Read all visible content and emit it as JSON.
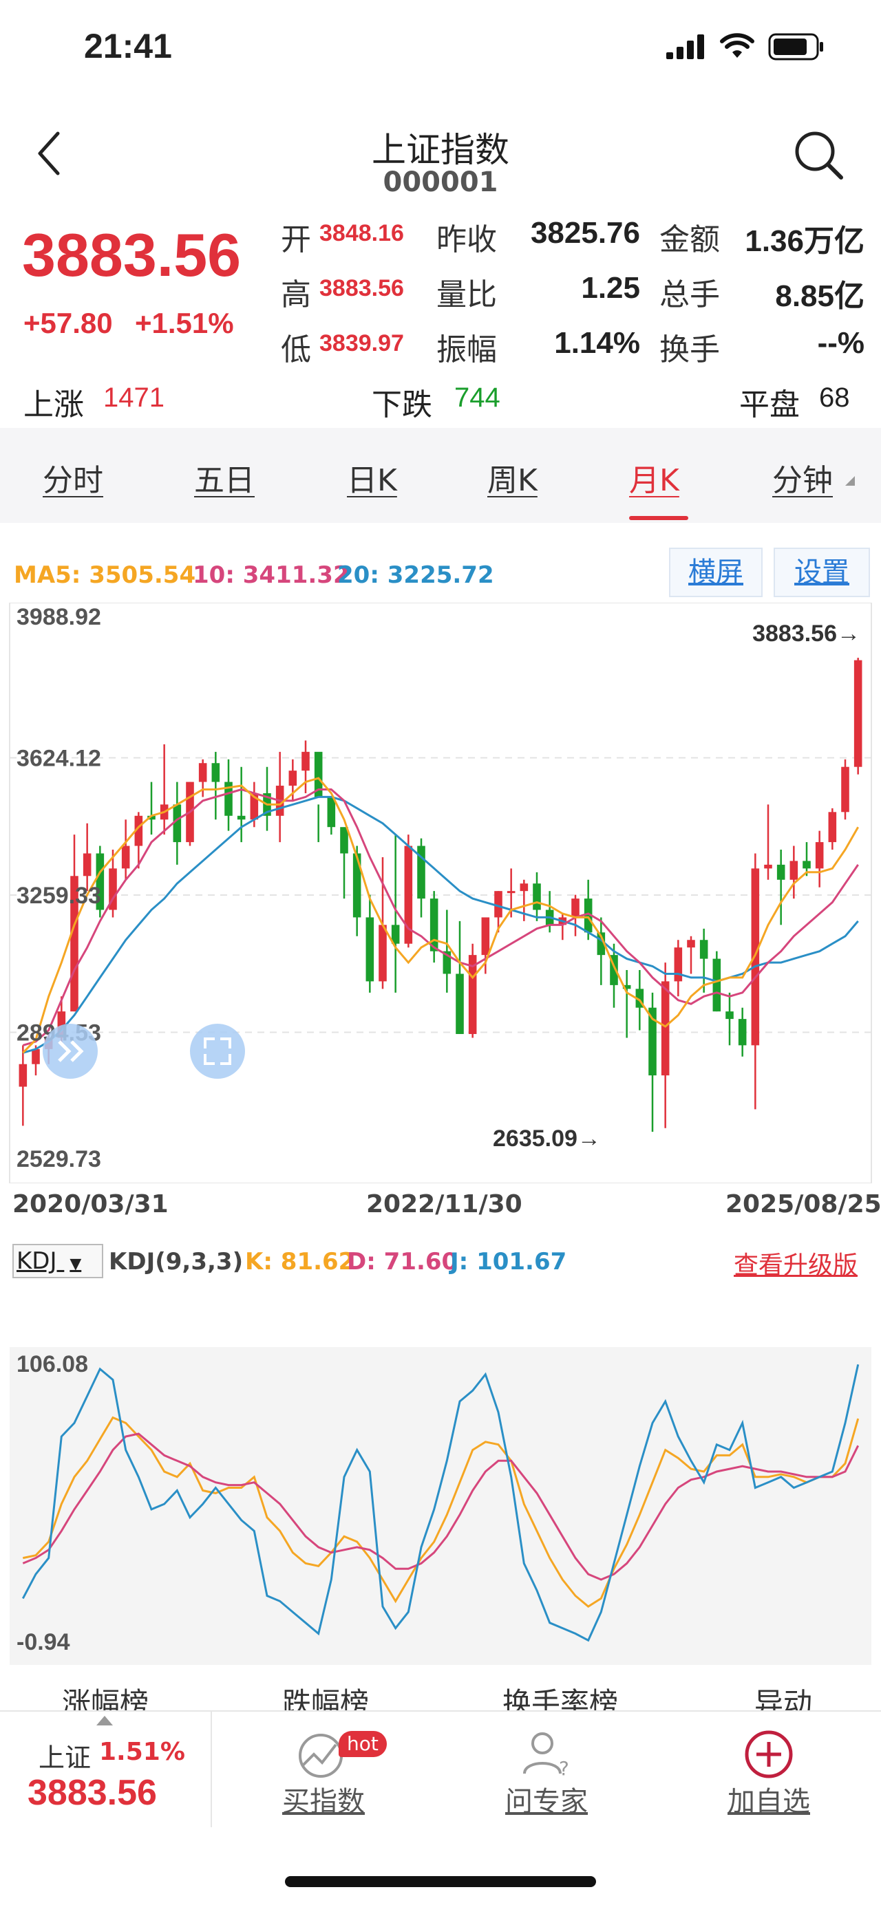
{
  "status_bar": {
    "time": "21:41"
  },
  "header": {
    "title": "上证指数",
    "code": "000001"
  },
  "quote": {
    "price": "3883.56",
    "change": "+57.80",
    "change_pct": "+1.51%",
    "stats": [
      {
        "label": "开",
        "value": "3848.16"
      },
      {
        "label": "昨收",
        "value": "3825.76"
      },
      {
        "label": "金额",
        "value": "1.36万亿"
      },
      {
        "label": "高",
        "value": "3883.56"
      },
      {
        "label": "量比",
        "value": "1.25"
      },
      {
        "label": "总手",
        "value": "8.85亿"
      },
      {
        "label": "低",
        "value": "3839.97"
      },
      {
        "label": "振幅",
        "value": "1.14%"
      },
      {
        "label": "换手",
        "value": "--%"
      }
    ],
    "breadth": {
      "up_label": "上涨",
      "up": "1471",
      "down_label": "下跌",
      "down": "744",
      "flat_label": "平盘",
      "flat": "68"
    }
  },
  "tabs": [
    "分时",
    "五日",
    "日K",
    "周K",
    "月K",
    "分钟"
  ],
  "active_tab": "月K",
  "ma_legend": {
    "ma5": "MA5: 3505.54",
    "ma10": "10: 3411.32",
    "ma20": "20: 3225.72"
  },
  "buttons": {
    "landscape": "横屏",
    "settings": "设置"
  },
  "kdj_legend": {
    "selector": "KDJ",
    "params": "KDJ(9,3,3)",
    "k": "K: 81.62",
    "d": "D: 71.60",
    "j": "J: 101.67",
    "upgrade": "查看升级版"
  },
  "lower_tabs": [
    "涨幅榜",
    "跌幅榜",
    "换手率榜",
    "异动"
  ],
  "bottom_bar": {
    "index_name": "上证",
    "index_pct": "1.51%",
    "index_price": "3883.56",
    "buy_index": "买指数",
    "hot_badge": "hot",
    "ask_expert": "问专家",
    "add_watch": "加自选"
  },
  "colors": {
    "up": "#e0313b",
    "down": "#1a9e2c",
    "ma5": "#f5a623",
    "ma10": "#d6467c",
    "ma20": "#2a8fc6"
  },
  "chart_data": [
    {
      "type": "candlestick",
      "title": "上证指数 月K",
      "y_ticks": [
        "3988.92",
        "3624.12",
        "3259.33",
        "2894.53",
        "2529.73"
      ],
      "ylim": [
        2529.73,
        3988.92
      ],
      "x_ticks": [
        "2020/03/31",
        "2022/11/30",
        "2025/08/25"
      ],
      "annotations": {
        "high": "3883.56→",
        "low": "2635.09→"
      },
      "ohlc": [
        [
          2750,
          2860,
          2646,
          2810
        ],
        [
          2810,
          2860,
          2780,
          2850
        ],
        [
          2850,
          2890,
          2810,
          2880
        ],
        [
          2880,
          2990,
          2860,
          2950
        ],
        [
          2950,
          3420,
          2950,
          3310
        ],
        [
          3310,
          3450,
          3270,
          3370
        ],
        [
          3370,
          3390,
          3200,
          3220
        ],
        [
          3220,
          3380,
          3200,
          3330
        ],
        [
          3330,
          3460,
          3300,
          3390
        ],
        [
          3390,
          3480,
          3330,
          3470
        ],
        [
          3470,
          3560,
          3420,
          3460
        ],
        [
          3460,
          3660,
          3420,
          3500
        ],
        [
          3500,
          3560,
          3340,
          3400
        ],
        [
          3400,
          3560,
          3390,
          3560
        ],
        [
          3560,
          3620,
          3520,
          3610
        ],
        [
          3610,
          3640,
          3460,
          3560
        ],
        [
          3560,
          3620,
          3430,
          3470
        ],
        [
          3470,
          3600,
          3400,
          3460
        ],
        [
          3460,
          3560,
          3440,
          3530
        ],
        [
          3530,
          3600,
          3430,
          3470
        ],
        [
          3470,
          3640,
          3400,
          3550
        ],
        [
          3550,
          3620,
          3510,
          3590
        ],
        [
          3590,
          3670,
          3530,
          3640
        ],
        [
          3640,
          3500,
          3400,
          3520
        ],
        [
          3520,
          3500,
          3420,
          3440
        ],
        [
          3440,
          3380,
          3250,
          3370
        ],
        [
          3370,
          3390,
          3150,
          3200
        ],
        [
          3200,
          3260,
          3000,
          3030
        ],
        [
          3030,
          3360,
          3010,
          3180
        ],
        [
          3180,
          3420,
          3000,
          3130
        ],
        [
          3130,
          3420,
          3120,
          3390
        ],
        [
          3390,
          3410,
          3200,
          3250
        ],
        [
          3250,
          3270,
          3080,
          3110
        ],
        [
          3110,
          3220,
          3000,
          3050
        ],
        [
          3050,
          3190,
          2890,
          2890
        ],
        [
          2890,
          3130,
          2880,
          3100
        ],
        [
          3100,
          3200,
          3050,
          3200
        ],
        [
          3200,
          3270,
          3160,
          3270
        ],
        [
          3270,
          3330,
          3200,
          3270
        ],
        [
          3270,
          3300,
          3190,
          3290
        ],
        [
          3290,
          3320,
          3190,
          3220
        ],
        [
          3220,
          3270,
          3160,
          3180
        ],
        [
          3180,
          3210,
          3140,
          3200
        ],
        [
          3200,
          3260,
          3150,
          3250
        ],
        [
          3250,
          3300,
          3140,
          3160
        ],
        [
          3160,
          3200,
          3020,
          3100
        ],
        [
          3100,
          3130,
          2960,
          3020
        ],
        [
          3020,
          3060,
          2880,
          3010
        ],
        [
          3010,
          3060,
          2900,
          2960
        ],
        [
          2960,
          3000,
          2630,
          2780
        ],
        [
          2780,
          3080,
          2640,
          3030
        ],
        [
          3030,
          3140,
          2990,
          3120
        ],
        [
          3120,
          3150,
          3050,
          3140
        ],
        [
          3140,
          3170,
          3000,
          3090
        ],
        [
          3090,
          3110,
          2950,
          2950
        ],
        [
          2950,
          3000,
          2860,
          2930
        ],
        [
          2930,
          2960,
          2830,
          2860
        ],
        [
          2860,
          3370,
          2690,
          3330
        ],
        [
          3330,
          3500,
          3300,
          3340
        ],
        [
          3340,
          3380,
          3180,
          3300
        ],
        [
          3300,
          3390,
          3250,
          3350
        ],
        [
          3350,
          3400,
          3310,
          3330
        ],
        [
          3330,
          3430,
          3280,
          3400
        ],
        [
          3400,
          3490,
          3380,
          3480
        ],
        [
          3480,
          3620,
          3460,
          3600
        ],
        [
          3600,
          3890,
          3580,
          3883.56
        ]
      ],
      "ma5": [
        2840,
        2875,
        2990,
        3080,
        3180,
        3260,
        3320,
        3360,
        3400,
        3440,
        3470,
        3480,
        3500,
        3520,
        3540,
        3540,
        3545,
        3550,
        3520,
        3500,
        3500,
        3530,
        3560,
        3570,
        3530,
        3460,
        3360,
        3250,
        3180,
        3120,
        3080,
        3120,
        3140,
        3130,
        3080,
        3040,
        3080,
        3170,
        3220,
        3230,
        3240,
        3230,
        3210,
        3200,
        3200,
        3150,
        3070,
        3000,
        2980,
        2930,
        2910,
        2940,
        2990,
        3020,
        3030,
        3040,
        3040,
        3100,
        3180,
        3240,
        3290,
        3320,
        3320,
        3330,
        3380,
        3440
      ],
      "ma10": [
        2860,
        2870,
        2900,
        2980,
        3060,
        3120,
        3190,
        3250,
        3300,
        3340,
        3400,
        3430,
        3460,
        3480,
        3510,
        3520,
        3530,
        3540,
        3530,
        3520,
        3510,
        3510,
        3520,
        3540,
        3540,
        3510,
        3440,
        3360,
        3290,
        3220,
        3170,
        3150,
        3120,
        3100,
        3080,
        3070,
        3090,
        3110,
        3130,
        3150,
        3170,
        3180,
        3180,
        3200,
        3210,
        3190,
        3150,
        3110,
        3080,
        3040,
        3010,
        2980,
        2970,
        2990,
        3000,
        2990,
        3000,
        3040,
        3080,
        3110,
        3150,
        3180,
        3210,
        3240,
        3290,
        3340
      ],
      "ma20": [
        2840,
        2850,
        2870,
        2900,
        2940,
        2990,
        3040,
        3090,
        3140,
        3180,
        3220,
        3250,
        3290,
        3320,
        3350,
        3380,
        3410,
        3440,
        3460,
        3480,
        3490,
        3500,
        3510,
        3520,
        3520,
        3510,
        3490,
        3470,
        3450,
        3420,
        3390,
        3360,
        3330,
        3300,
        3270,
        3250,
        3240,
        3230,
        3220,
        3210,
        3200,
        3200,
        3190,
        3180,
        3160,
        3140,
        3110,
        3090,
        3080,
        3070,
        3050,
        3050,
        3040,
        3040,
        3030,
        3040,
        3050,
        3070,
        3080,
        3080,
        3090,
        3100,
        3110,
        3130,
        3150,
        3190
      ]
    },
    {
      "type": "line",
      "title": "KDJ(9,3,3)",
      "y_ticks": [
        "106.08",
        "-0.94"
      ],
      "ylim": [
        -0.94,
        106.08
      ],
      "series": [
        {
          "name": "K",
          "values": [
            30,
            31,
            36,
            50,
            60,
            66,
            74,
            82,
            80,
            75,
            70,
            62,
            60,
            65,
            55,
            54,
            56,
            56,
            60,
            45,
            40,
            32,
            28,
            27,
            32,
            38,
            36,
            30,
            22,
            14,
            22,
            30,
            36,
            46,
            58,
            70,
            73,
            72,
            66,
            50,
            40,
            30,
            22,
            16,
            12,
            15,
            26,
            35,
            46,
            58,
            70,
            67,
            63,
            62,
            68,
            68,
            72,
            60,
            60,
            61,
            60,
            58,
            60,
            60,
            65,
            81.62
          ]
        },
        {
          "name": "D",
          "values": [
            28,
            30,
            33,
            40,
            48,
            55,
            62,
            70,
            75,
            76,
            72,
            68,
            66,
            64,
            60,
            58,
            57,
            57,
            58,
            54,
            50,
            44,
            38,
            34,
            32,
            33,
            34,
            33,
            30,
            26,
            26,
            28,
            32,
            38,
            46,
            55,
            62,
            66,
            66,
            60,
            54,
            46,
            38,
            30,
            24,
            22,
            24,
            28,
            34,
            42,
            50,
            56,
            59,
            60,
            62,
            63,
            64,
            63,
            62,
            62,
            61,
            60,
            60,
            60,
            62,
            71.6
          ]
        },
        {
          "name": "J",
          "values": [
            15,
            24,
            30,
            75,
            80,
            90,
            100,
            96,
            70,
            60,
            48,
            50,
            55,
            45,
            50,
            56,
            50,
            44,
            40,
            16,
            14,
            10,
            6,
            2,
            22,
            60,
            70,
            62,
            12,
            4,
            10,
            34,
            48,
            66,
            88,
            92,
            98,
            84,
            60,
            28,
            18,
            6,
            4,
            2,
            -0.5,
            10,
            28,
            46,
            64,
            80,
            88,
            75,
            66,
            58,
            72,
            70,
            80,
            56,
            58,
            60,
            56,
            58,
            60,
            62,
            80,
            101.67
          ]
        }
      ]
    }
  ]
}
